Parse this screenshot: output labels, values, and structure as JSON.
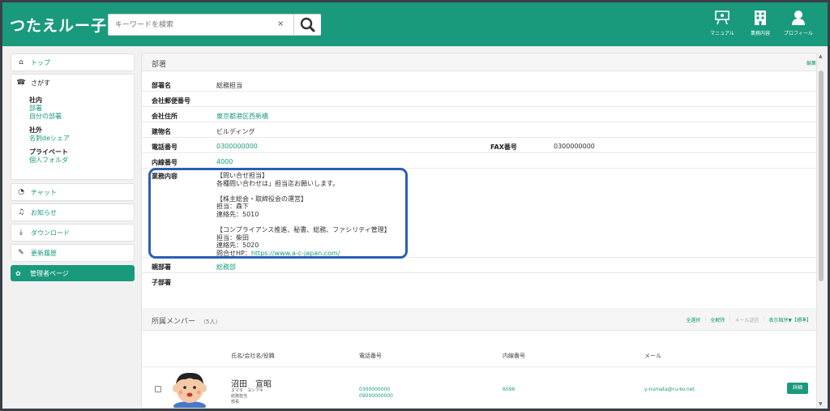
{
  "app": {
    "title": "つたえルー子"
  },
  "search": {
    "placeholder": "キーワードを検索",
    "clear": "×"
  },
  "header_icons": [
    {
      "name": "manual",
      "label": "マニュアル"
    },
    {
      "name": "business",
      "label": "業務内容"
    },
    {
      "name": "profile",
      "label": "プロフィール"
    }
  ],
  "sidebar": {
    "top": "トップ",
    "search_title": "さがす",
    "groups": [
      {
        "title": "社内",
        "links": [
          "部署",
          "自分の部署"
        ]
      },
      {
        "title": "社外",
        "links": [
          "名刺deシェア"
        ]
      },
      {
        "title": "プライベート",
        "links": [
          "個人フォルダ"
        ]
      }
    ],
    "chat": "チャット",
    "notice": "お知らせ",
    "download": "ダウンロード",
    "history": "更新履歴",
    "admin": "管理者ページ"
  },
  "dept": {
    "section_title": "部署",
    "edit": "編集",
    "rows": {
      "name": {
        "label": "部署名",
        "value": "総務担当"
      },
      "postal": {
        "label": "会社郵便番号",
        "value": ""
      },
      "address": {
        "label": "会社住所",
        "value": "東京都港区西新橋"
      },
      "building": {
        "label": "建物名",
        "value": "ビルディング"
      },
      "phone": {
        "label": "電話番号",
        "value": "0300000000"
      },
      "fax": {
        "label": "FAX番号",
        "value": "0300000000"
      },
      "ext": {
        "label": "内線番号",
        "value": "4000"
      },
      "business": {
        "label": "業務内容",
        "value": "【問い合せ担当】\n各種問い合わせは」担当迄お願いします。\n\n【株主総会・取締役会の運営】\n担当：森下\n連絡先：5010\n\n【コンプライアンス推進、秘書、総務、ファシリティ管理】\n担当：柴田\n連絡先：5020\n問合せHP：",
        "url": "https://www.a-c-japan.com/"
      },
      "parent": {
        "label": "親部署",
        "value": "総務部"
      },
      "child": {
        "label": "子部署",
        "value": ""
      }
    }
  },
  "members": {
    "title": "所属メンバー",
    "count": "（5人）",
    "tools": {
      "select_all": "全選択",
      "clear_all": "全解除",
      "send_mail": "メール送信",
      "sort": "表示順序▼【標準】"
    },
    "columns": {
      "name": "氏名/会社名/役職",
      "phone": "電話番号",
      "ext": "内線番号",
      "mail": "メール"
    },
    "rows": [
      {
        "name": "沼田　宣昭",
        "kana": "ヌマタ　ヨシアキ",
        "dept": "総務担当",
        "role": "部長",
        "phone1": "0300000000",
        "phone2": "09000000000",
        "ext": "6096",
        "mail": "y-numata@ru-ko.net",
        "detail": "詳細"
      }
    ]
  },
  "colors": {
    "brand": "#1a9a7d",
    "highlight": "#2b60b0"
  }
}
